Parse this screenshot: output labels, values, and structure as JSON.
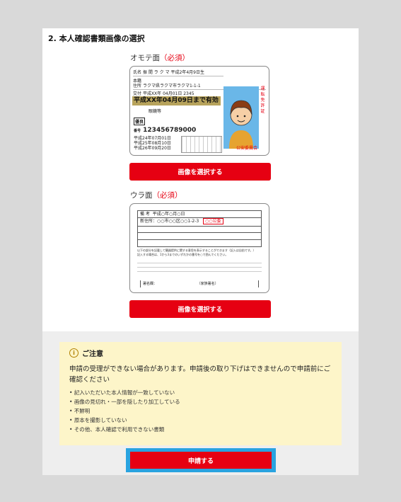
{
  "section": {
    "title": "2. 本人確認書類画像の選択"
  },
  "front": {
    "label": "オモテ面",
    "required": "（必須）",
    "button": "画像を選択する",
    "license": {
      "name_key": "氏名",
      "name": "振 間 ラ ク マ",
      "birth": "平成2年4月9日生",
      "domicile_key": "本籍",
      "address_key": "住所",
      "address": "ラクマ県ラクマ市ラクマ1-1-1",
      "issue_key": "交付",
      "issue": "平成XX年 04月01日    2345",
      "expiry": "平成XX年04月09日まで有効",
      "conditions": "眼鏡等",
      "excellent": "優良",
      "number_key": "番号",
      "number": "123456789000",
      "history": [
        "平成24年07月01日",
        "平成25年08月10日",
        "平成26年09月20日"
      ],
      "vertical": "運転免許証",
      "issuer": "公安委員会"
    }
  },
  "back": {
    "label": "ウラ面",
    "required": "（必須）",
    "button": "画像を選択する",
    "license": {
      "remarks_key": "備 考",
      "remarks_date": "平成○年○月○日",
      "new_address": "新住所：○○市○○区○○1-2-3",
      "seal": "○○公委",
      "organ_text": "以下の部分を記載して臓器提供に関する意思を表示することができます（記入は自由です。）",
      "organ_note": "記入する場合は、1から3までのいずれかの番号を○で囲んでください。",
      "signature_key": "署名欄：",
      "family_key": "（家族署名）"
    }
  },
  "notice": {
    "title": "ご注意",
    "lead": "申請の受理ができない場合があります。申請後の取り下げはできませんので申請前にご確認ください",
    "items": [
      "記入いただいた本人情報が一致していない",
      "画像の見切れ・一部を隠したり加工している",
      "不鮮明",
      "原本を撮影していない",
      "その他、本人確認で利用できない書類"
    ]
  },
  "submit": {
    "label": "申請する"
  },
  "colors": {
    "accent": "#e60012",
    "notice_bg": "#fdf5c9",
    "focus_ring": "#29a3e0"
  }
}
